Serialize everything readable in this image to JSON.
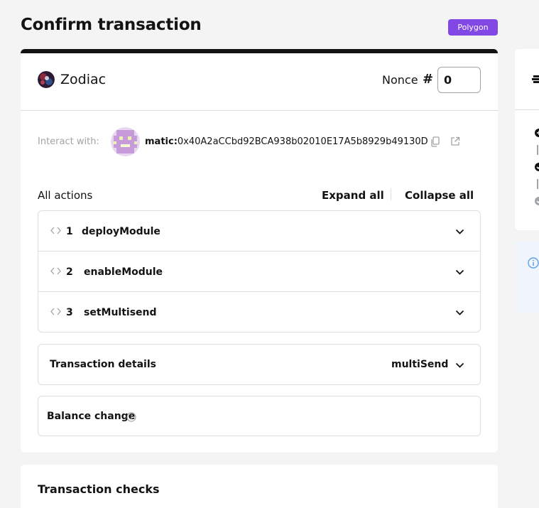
{
  "page": {
    "title": "Confirm transaction",
    "network": "Polygon",
    "network_color": "#8248e5"
  },
  "header": {
    "safe_name": "Zodiac",
    "nonce_label": "Nonce",
    "nonce_symbol": "#",
    "nonce_value": "0"
  },
  "interact": {
    "label": "Interact with:",
    "chain_prefix": "matic:",
    "address": "0x40A2aCCbd92BCA938b02010E17A5b8929b49130D",
    "copy_icon": "copy-icon",
    "link_icon": "external-link-icon"
  },
  "actions": {
    "title": "All actions",
    "expand_label": "Expand all",
    "collapse_label": "Collapse all",
    "items": [
      {
        "number": "1",
        "name": "deployModule"
      },
      {
        "number": "2",
        "name": "enableModule"
      },
      {
        "number": "3",
        "name": "setMultisend"
      }
    ]
  },
  "details": {
    "title": "Transaction details",
    "method": "multiSend"
  },
  "balance": {
    "title": "Balance change"
  },
  "checks": {
    "title": "Transaction checks"
  }
}
